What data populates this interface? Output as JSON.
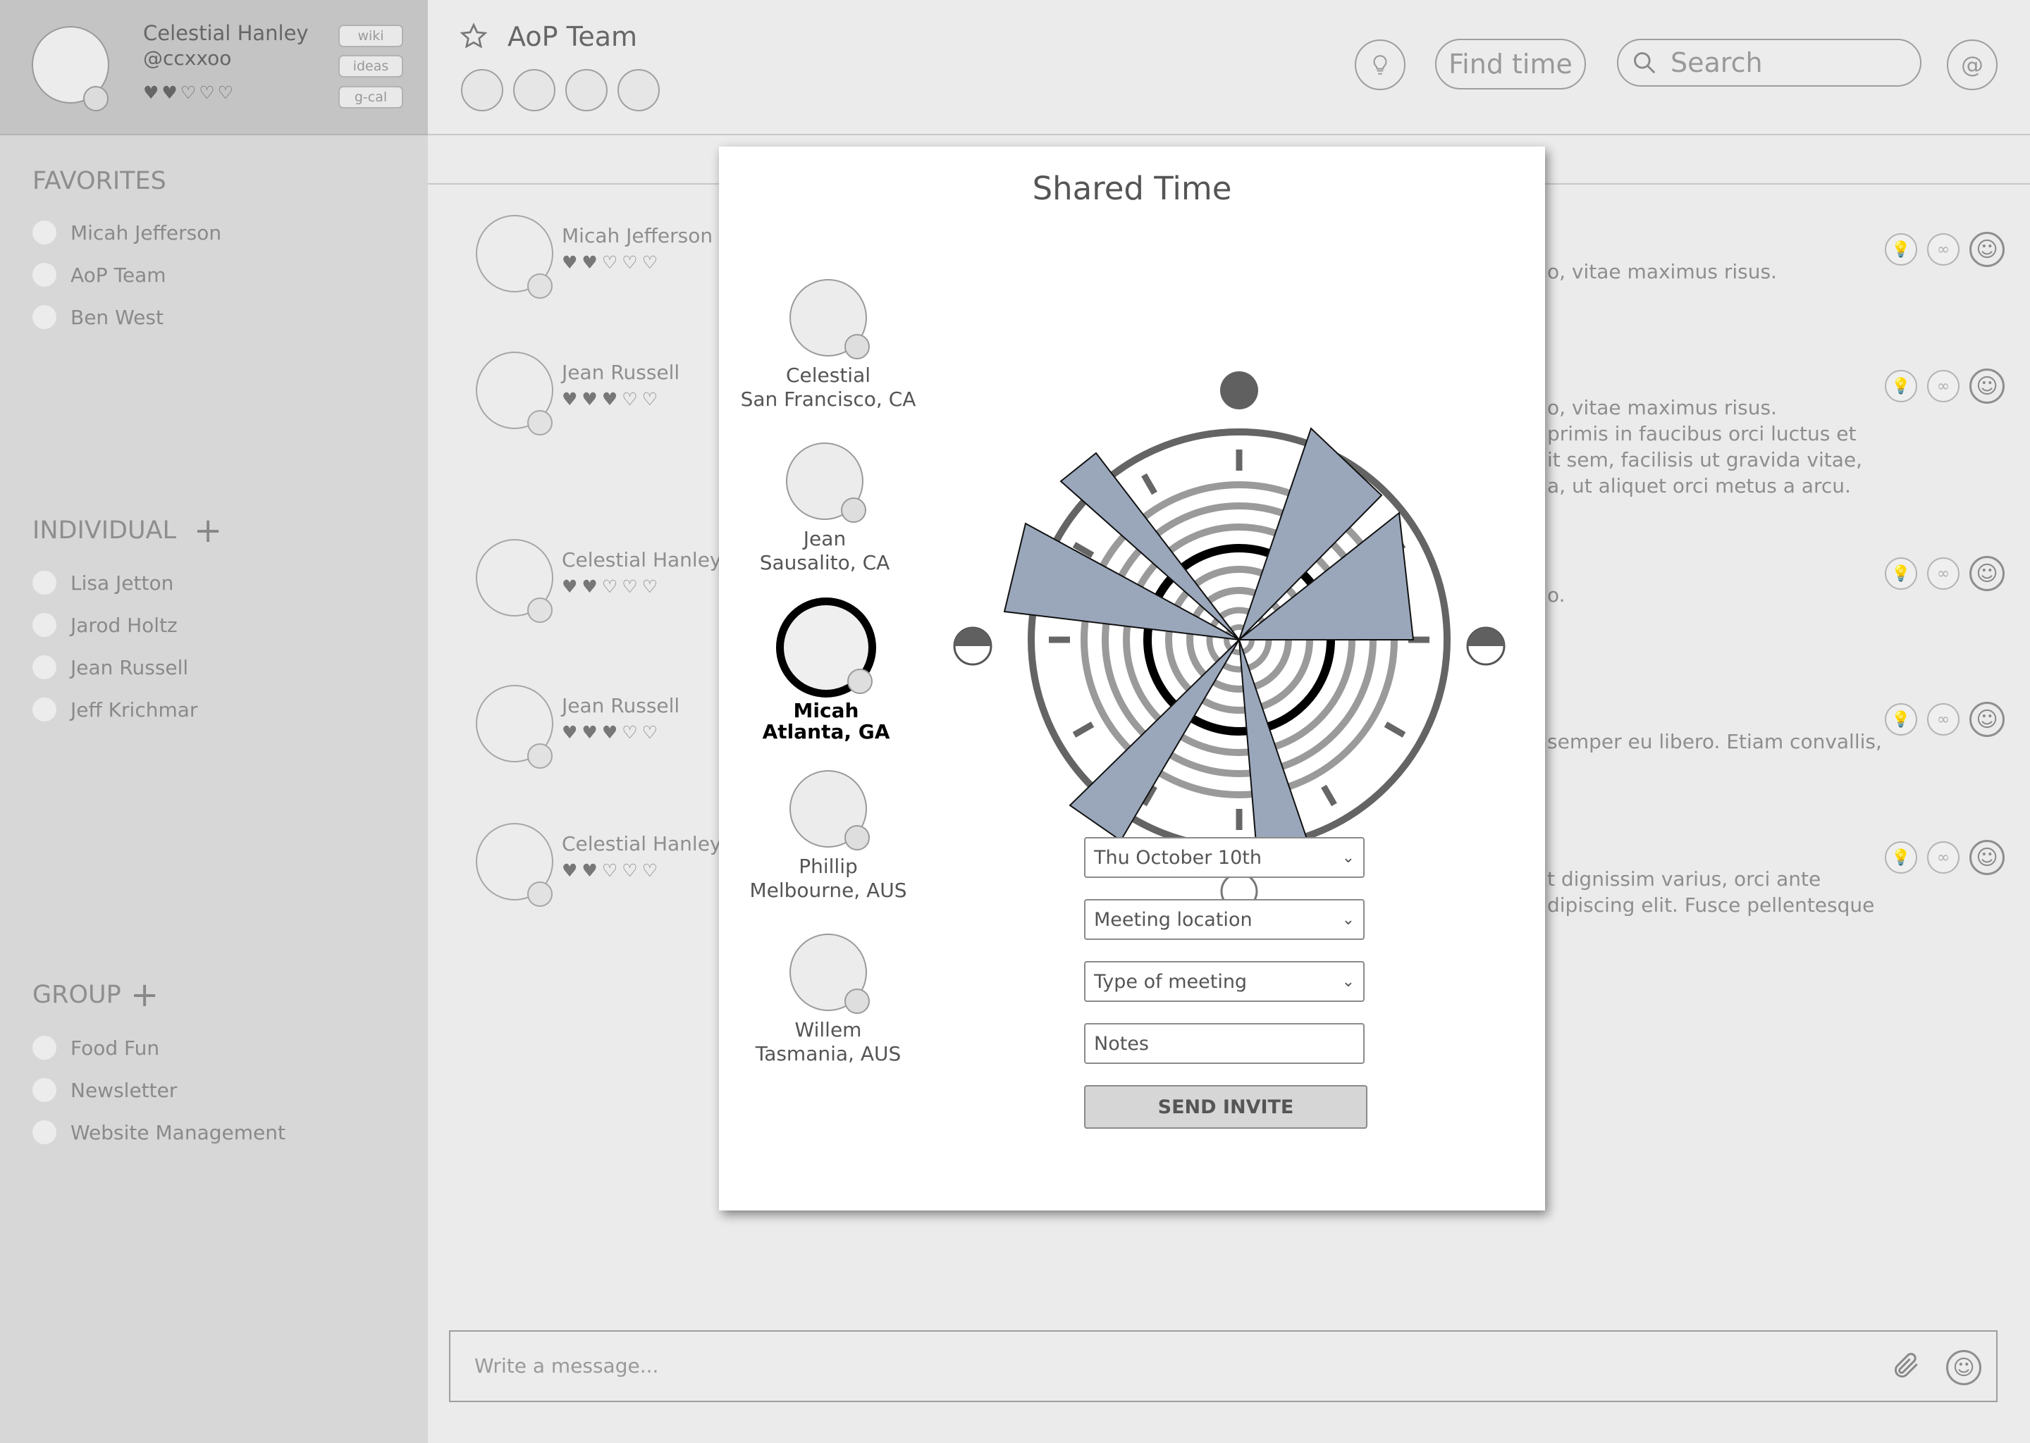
{
  "profile": {
    "name": "Celestial Hanley",
    "handle": "@ccxxoo",
    "hearts": "♥♥♡♡♡",
    "pills": [
      "wiki",
      "ideas",
      "g-cal"
    ]
  },
  "sidebar": {
    "favorites": {
      "title": "FAVORITES",
      "items": [
        "Micah Jefferson",
        "AoP Team",
        "Ben West"
      ]
    },
    "individual": {
      "title": "INDIVIDUAL",
      "plus": "+",
      "items": [
        "Lisa Jetton",
        "Jarod Holtz",
        "Jean Russell",
        "Jeff Krichmar"
      ]
    },
    "group": {
      "title": "GROUP",
      "plus": "+",
      "items": [
        "Food Fun",
        "Newsletter",
        "Website Management"
      ]
    }
  },
  "header": {
    "star_icon": "star-icon",
    "team_name": "AoP Team",
    "find_time": "Find time",
    "search_placeholder": "Search",
    "at_symbol": "@"
  },
  "messages": [
    {
      "name": "Micah Jefferson",
      "hearts": "♥♥♡♡♡",
      "text": [
        "o, vitae maximus risus."
      ]
    },
    {
      "name": "Jean Russell",
      "hearts": "♥♥♥♡♡",
      "text": [
        "o, vitae maximus risus.",
        "primis in faucibus orci luctus et",
        "it sem, facilisis ut gravida vitae,",
        "a, ut aliquet orci metus a arcu."
      ]
    },
    {
      "name": "Celestial Hanley",
      "hearts": "♥♥♡♡♡",
      "text": [
        "o."
      ]
    },
    {
      "name": "Jean Russell",
      "hearts": "♥♥♥♡♡",
      "text": [
        "semper eu libero. Etiam convallis,"
      ]
    },
    {
      "name": "Celestial Hanley",
      "hearts": "♥♥♡♡♡",
      "text": [
        "t dignissim varius, orci ante",
        "dipiscing elit. Fusce pellentesque"
      ]
    }
  ],
  "composer": {
    "placeholder": "Write a message..."
  },
  "modal": {
    "title": "Shared Time",
    "people": [
      {
        "name": "Celestial",
        "location": "San Francisco, CA",
        "selected": false
      },
      {
        "name": "Jean",
        "location": "Sausalito, CA",
        "selected": false
      },
      {
        "name": "Micah",
        "location": "Atlanta, GA",
        "selected": true
      },
      {
        "name": "Phillip",
        "location": "Melbourne, AUS",
        "selected": false
      },
      {
        "name": "Willem",
        "location": "Tasmania, AUS",
        "selected": false
      }
    ],
    "date_select": "Thu October 10th",
    "location_select": "Meeting location",
    "type_select": "Type of meeting",
    "notes_placeholder": "Notes",
    "send_label": "SEND INVITE"
  },
  "colors": {
    "wedge": "#9aa7bb",
    "modal_bg": "#ffffff",
    "sidebar": "#d7d7d7"
  }
}
